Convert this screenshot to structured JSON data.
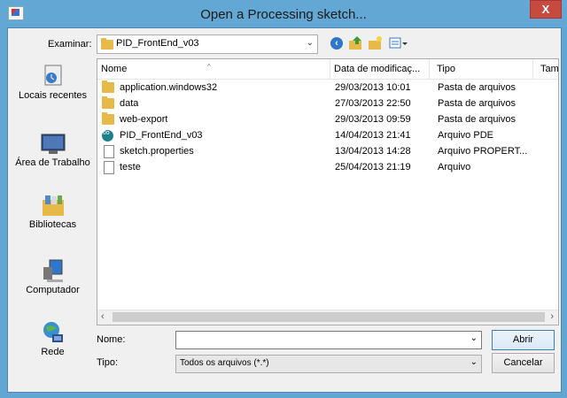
{
  "window": {
    "title": "Open a Processing sketch...",
    "close_label": "X"
  },
  "lookin": {
    "label": "Examinar:",
    "value": "PID_FrontEnd_v03"
  },
  "toolbar": {
    "back_icon": "arrow-left-icon",
    "up_icon": "folder-up-icon",
    "new_folder_icon": "new-folder-icon",
    "view_icon": "view-menu-icon"
  },
  "places": [
    {
      "label": "Locais recentes",
      "icon": "recent-places-icon"
    },
    {
      "label": "Área de Trabalho",
      "icon": "desktop-icon"
    },
    {
      "label": "Bibliotecas",
      "icon": "libraries-icon"
    },
    {
      "label": "Computador",
      "icon": "computer-icon"
    },
    {
      "label": "Rede",
      "icon": "network-icon"
    }
  ],
  "columns": [
    "Nome",
    "Data de modificaç...",
    "Tipo",
    "Tam"
  ],
  "files": [
    {
      "name": "application.windows32",
      "date": "29/03/2013 10:01",
      "type": "Pasta de arquivos",
      "icon": "folder-icon"
    },
    {
      "name": "data",
      "date": "27/03/2013 22:50",
      "type": "Pasta de arquivos",
      "icon": "folder-icon"
    },
    {
      "name": "web-export",
      "date": "29/03/2013 09:59",
      "type": "Pasta de arquivos",
      "icon": "folder-icon"
    },
    {
      "name": "PID_FrontEnd_v03",
      "date": "14/04/2013 21:41",
      "type": "Arquivo PDE",
      "icon": "processing-file-icon"
    },
    {
      "name": "sketch.properties",
      "date": "13/04/2013 14:28",
      "type": "Arquivo PROPERT...",
      "icon": "file-icon"
    },
    {
      "name": "teste",
      "date": "25/04/2013 21:19",
      "type": "Arquivo",
      "icon": "file-icon"
    }
  ],
  "filename": {
    "label": "Nome:",
    "value": ""
  },
  "filetype": {
    "label": "Tipo:",
    "value": "Todos os arquivos (*.*)"
  },
  "buttons": {
    "open": "Abrir",
    "cancel": "Cancelar"
  }
}
